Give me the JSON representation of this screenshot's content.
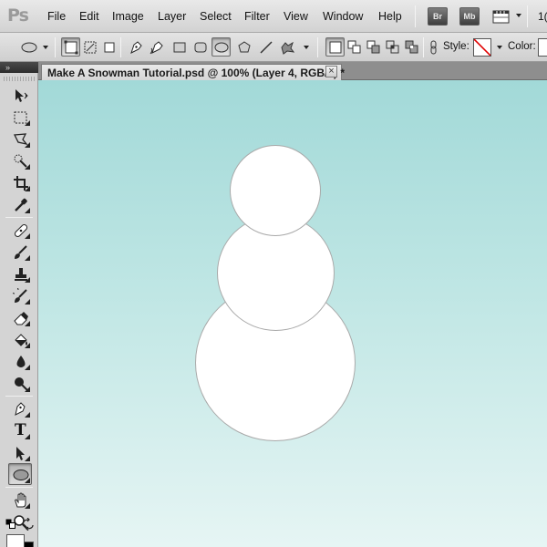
{
  "app": {
    "logo": "Ps",
    "menu": [
      "File",
      "Edit",
      "Image",
      "Layer",
      "Select",
      "Filter",
      "View",
      "Window",
      "Help"
    ],
    "badges": [
      "Br",
      "Mb"
    ],
    "zoom_readout": "1("
  },
  "options_bar": {
    "style_label": "Style:",
    "color_label": "Color:",
    "style_swatch": "none-red-slash",
    "color_value": "#ffffff",
    "icons": [
      "ellipse-preset-icon",
      "shape-layers-icon",
      "paths-icon",
      "fill-pixels-icon",
      "pen-icon",
      "freeform-pen-icon",
      "rectangle-icon",
      "rounded-rectangle-icon",
      "ellipse-icon",
      "polygon-icon",
      "line-icon",
      "custom-shape-icon",
      "new-layer-icon",
      "add-icon",
      "subtract-icon",
      "intersect-icon",
      "exclude-icon",
      "link-icon"
    ],
    "active_shape": "ellipse-icon"
  },
  "document": {
    "tab_title": "Make A Snowman Tutorial.psd @ 100% (Layer 4, RGB/8) *",
    "close_glyph": "×",
    "background_top": "#a2d9d8",
    "background_bottom": "#e6f5f4"
  },
  "tools": {
    "items": [
      "move-tool",
      "marquee-tool",
      "lasso-tool",
      "quick-selection-tool",
      "crop-tool",
      "eyedropper-tool",
      "healing-brush-tool",
      "brush-tool",
      "clone-stamp-tool",
      "history-brush-tool",
      "eraser-tool",
      "paint-bucket-tool",
      "blur-tool",
      "dodge-tool",
      "pen-tool",
      "type-tool",
      "path-selection-tool",
      "ellipse-tool",
      "hand-tool",
      "zoom-tool"
    ],
    "active": "ellipse-tool",
    "type_glyph": "T",
    "foreground_color": "#ffffff",
    "background_color": "#000000"
  }
}
